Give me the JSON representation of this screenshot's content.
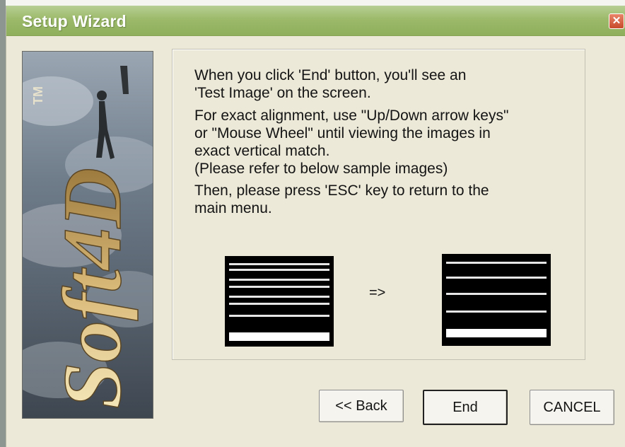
{
  "window": {
    "title": "Setup Wizard",
    "close_glyph": "✕"
  },
  "banner": {
    "brand_text": "Soft4D",
    "tm": "TM"
  },
  "instructions": [
    "When you click 'End' button, you'll see an",
    "'Test Image' on the screen.",
    "For exact alignment, use \"Up/Down arrow keys\"",
    "or \"Mouse Wheel\" until viewing the images in",
    "exact vertical match.",
    "(Please refer to below sample images)",
    "Then, please press 'ESC' key to return to the",
    "main menu."
  ],
  "samples": {
    "arrow": "=>"
  },
  "buttons": {
    "back": "<< Back",
    "end": "End",
    "cancel": "CANCEL"
  },
  "colors": {
    "titlebar": "#9CBA6A",
    "dialog_bg": "#ECE9D8",
    "close": "#D0583A"
  }
}
